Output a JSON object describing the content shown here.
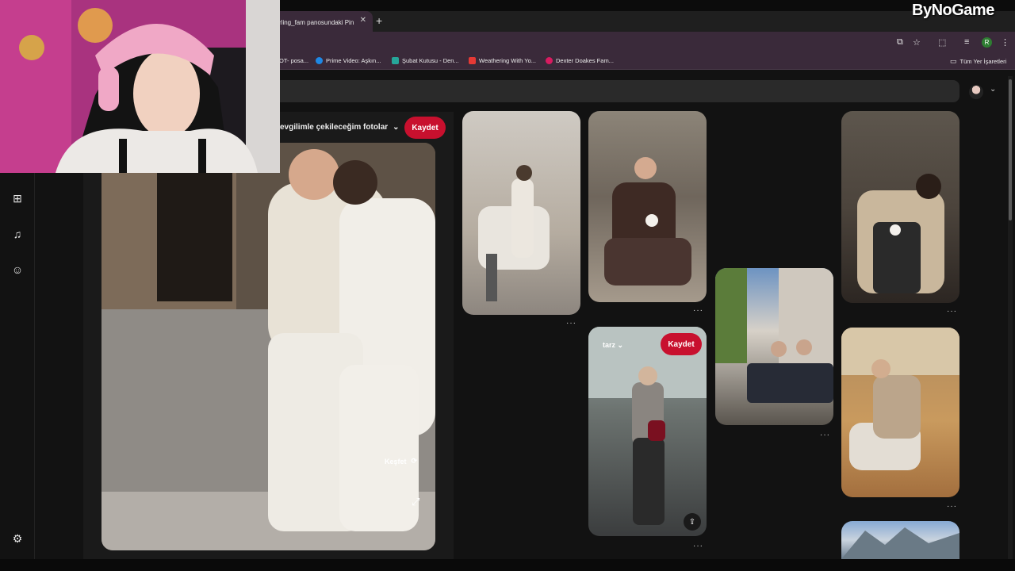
{
  "watermark": "ByNoGame",
  "browser": {
    "tab_title": "rling_fam panosundaki Pin",
    "bookmarks": [
      {
        "label": "OT- posa...",
        "color": "#888888"
      },
      {
        "label": "Prime Video: Aşkın...",
        "color": "#1e88e5"
      },
      {
        "label": "Şubat Kutusu - Den...",
        "color": "#26a69a"
      },
      {
        "label": "Weathering With Yo...",
        "color": "#e53935"
      },
      {
        "label": "Dexter Doakes Fam...",
        "color": "#d81b60"
      }
    ],
    "all_bookmarks": "Tüm Yer İşaretleri",
    "profile_initial": "R"
  },
  "pin_closeup": {
    "board_name": "evgilimle çekileceğim fotolar",
    "save_label": "Kaydet",
    "explore_label": "Keşfet"
  },
  "grid": {
    "hover_pin": {
      "board": "tarz",
      "save_label": "Kaydet"
    },
    "more_label": "···"
  }
}
